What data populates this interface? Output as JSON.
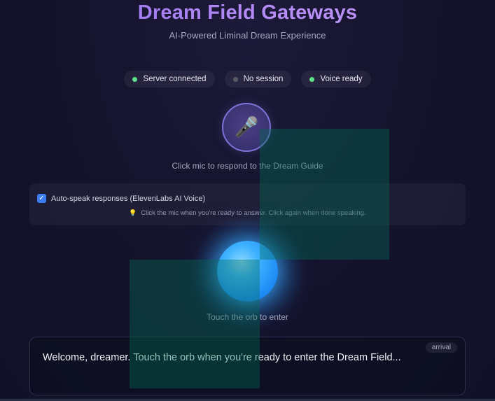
{
  "header": {
    "title": "Dream Field Gateways",
    "subtitle": "AI-Powered Liminal Dream Experience"
  },
  "status": [
    {
      "label": "Server connected",
      "color": "#5fe38a"
    },
    {
      "label": "No session",
      "color": "#5a5a66"
    },
    {
      "label": "Voice ready",
      "color": "#5fe38a"
    }
  ],
  "mic": {
    "icon": "microphone-icon",
    "glyph": "🎤",
    "hint": "Click mic to respond to the Dream Guide"
  },
  "settings": {
    "auto_speak_label": "Auto-speak responses (ElevenLabs AI Voice)",
    "auto_speak_checked": true,
    "tip_icon": "lightbulb-icon",
    "tip_glyph": "💡",
    "tip_text": "Click the mic when you're ready to answer. Click again when done speaking."
  },
  "orb": {
    "hint": "Touch the orb to enter"
  },
  "message": {
    "phase": "arrival",
    "text": "Welcome, dreamer. Touch the orb when you're ready to enter the Dream Field..."
  },
  "colors": {
    "accent": "#9b7af2",
    "orb": "#3fb3ff",
    "checkbox": "#3b7cf0"
  }
}
